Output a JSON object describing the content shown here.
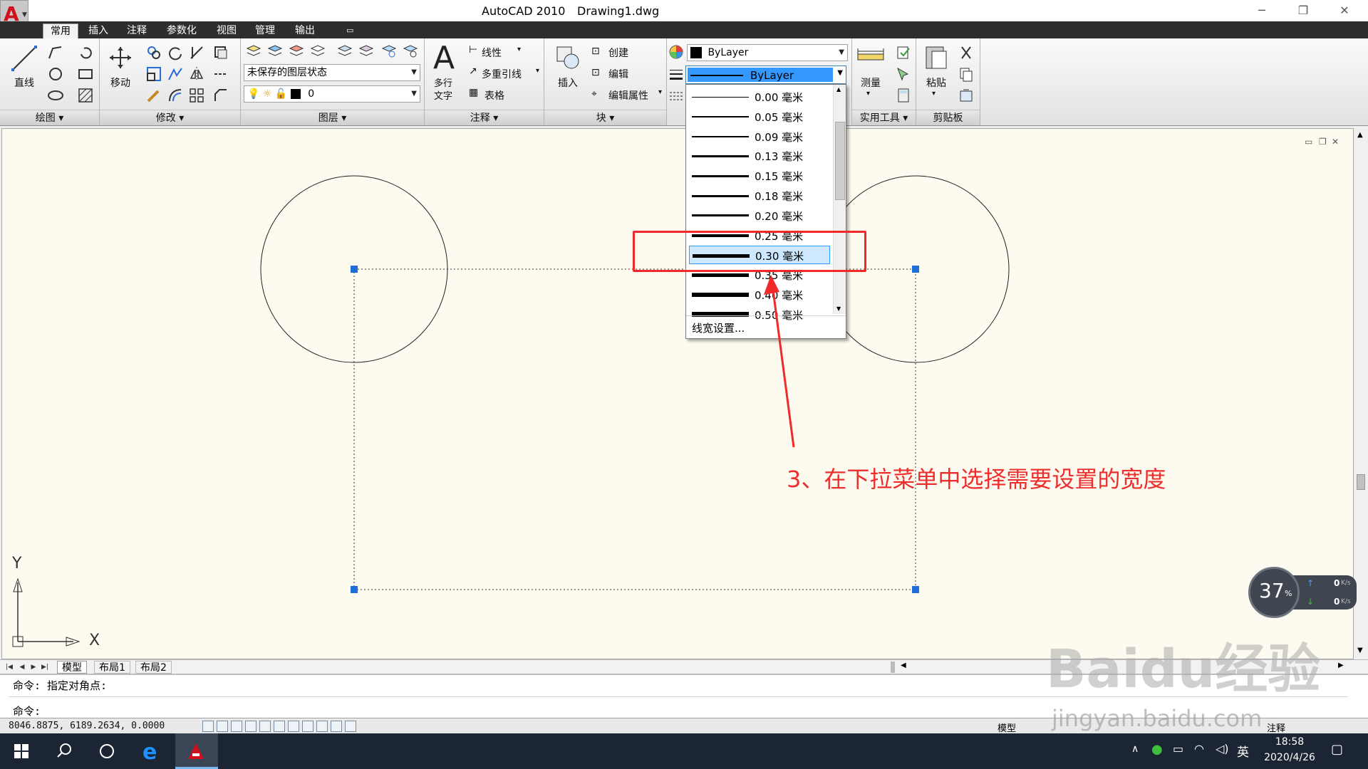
{
  "window": {
    "title": "AutoCAD 2010",
    "file": "Drawing1.dwg"
  },
  "ribbon_tabs": [
    "常用",
    "插入",
    "注释",
    "参数化",
    "视图",
    "管理",
    "输出"
  ],
  "panels": {
    "draw": {
      "label": "绘图 ▾",
      "line_label": "直线"
    },
    "modify": {
      "label": "修改 ▾",
      "move_label": "移动"
    },
    "layers": {
      "label": "图层 ▾",
      "layer_state": "未保存的图层状态",
      "layer_name": "0"
    },
    "annotation": {
      "label": "注释 ▾",
      "mtext_label_1": "多行",
      "mtext_label_2": "文字",
      "linear": "线性",
      "multileader": "多重引线",
      "table": "表格"
    },
    "block": {
      "label": "块 ▾",
      "insert": "插入",
      "create": "创建",
      "edit": "编辑",
      "edit_attr": "编辑属性"
    },
    "properties": {
      "color_value": "ByLayer",
      "lineweight_value": "ByLayer"
    },
    "utilities": {
      "label": "实用工具 ▾",
      "measure": "测量"
    },
    "clipboard": {
      "label": "剪贴板",
      "paste": "粘贴"
    }
  },
  "lineweight_dropdown": {
    "items": [
      {
        "label": "0.00 毫米",
        "weight": 0.0
      },
      {
        "label": "0.05 毫米",
        "weight": 0.05
      },
      {
        "label": "0.09 毫米",
        "weight": 0.09
      },
      {
        "label": "0.13 毫米",
        "weight": 0.13
      },
      {
        "label": "0.15 毫米",
        "weight": 0.15
      },
      {
        "label": "0.18 毫米",
        "weight": 0.18
      },
      {
        "label": "0.20 毫米",
        "weight": 0.2
      },
      {
        "label": "0.25 毫米",
        "weight": 0.25
      },
      {
        "label": "0.30 毫米",
        "weight": 0.3
      },
      {
        "label": "0.35 毫米",
        "weight": 0.35
      },
      {
        "label": "0.40 毫米",
        "weight": 0.4
      },
      {
        "label": "0.50 毫米",
        "weight": 0.5
      }
    ],
    "selected": "0.30 毫米",
    "settings_label": "线宽设置..."
  },
  "annotation": {
    "text": "3、在下拉菜单中选择需要设置的宽度",
    "color": "#ee2d2d"
  },
  "layout_tabs": [
    "模型",
    "布局1",
    "布局2"
  ],
  "axes": {
    "x": "X",
    "y": "Y"
  },
  "command": {
    "line1": "命令: 指定对角点:",
    "line2": "命令:"
  },
  "status": {
    "coords": "8046.8875,  6189.2634,  0.0000",
    "model": "模型",
    "annot": "注释"
  },
  "taskbar": {
    "ime": "英",
    "time": "18:58",
    "date": "2020/4/26"
  },
  "speed_widget": {
    "percent": "37",
    "unit": "%",
    "up": "0",
    "down": "0",
    "rate_unit": "K/s"
  },
  "watermark": {
    "text": "Baidu经验",
    "url": "jingyan.baidu.com"
  }
}
